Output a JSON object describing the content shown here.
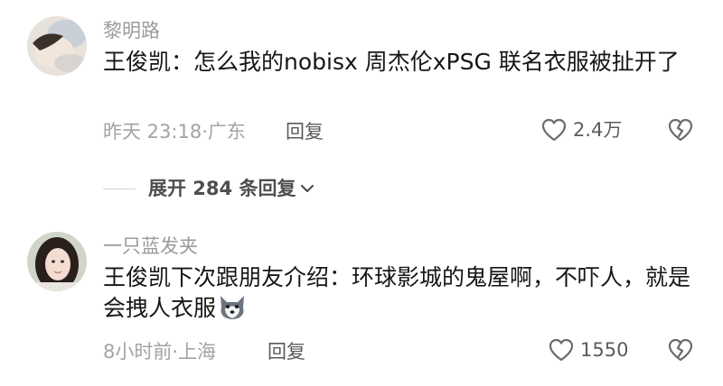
{
  "comments": [
    {
      "username": "黎明路",
      "text": "王俊凯：怎么我的nobisx 周杰伦xPSG 联名衣服被扯开了",
      "time_location": "昨天 23:18·广东",
      "reply_label": "回复",
      "like_count": "2.4万"
    },
    {
      "username": "一只蓝发夹",
      "text": "王俊凯下次跟朋友介绍：环球影城的鬼屋啊，不吓人，就是会拽人衣服",
      "time_location": "8小时前·上海",
      "reply_label": "回复",
      "like_count": "1550",
      "emoji": "wolf-emoji"
    }
  ],
  "expand_replies": {
    "label": "展开 284 条回复"
  },
  "icons": {
    "like": "heart-outline-icon",
    "dislike": "broken-heart-icon",
    "expand": "chevron-down-icon"
  },
  "colors": {
    "text_primary": "#161616",
    "text_secondary": "#9b9b9b",
    "icon": "#6b6b6b"
  }
}
